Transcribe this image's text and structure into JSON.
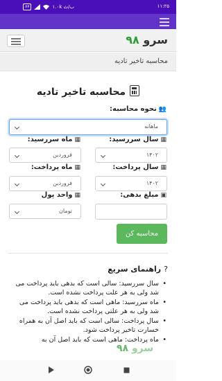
{
  "status_bar": {
    "time": "۱۱:۲۵",
    "network": "۱.۰k ب/ث",
    "battery": "۸۷",
    "wifi_icon": "wifi-icon",
    "signal_icon": "signal-icon"
  },
  "site": {
    "brand_text": "سرو",
    "brand_number": "۹۸",
    "menu_icon": "hamburger-icon"
  },
  "breadcrumb": {
    "current": "محاسبه تاخیر تادیه"
  },
  "page": {
    "title": "محاسبه تاخیر تادیه",
    "title_icon": "calculator-icon"
  },
  "form": {
    "method_label": "نحوه محاسبه:",
    "method_value": "ماهانه",
    "due_year_label": "سال سررسید:",
    "due_year_value": "۱۴۰۲",
    "due_month_label": "ماه سررسید:",
    "due_month_value": "فروردین",
    "pay_year_label": "سال پرداخت:",
    "pay_year_value": "۱۴۰۲",
    "pay_month_label": "ماه پرداخت:",
    "pay_month_value": "فروردین",
    "debt_label": "مبلغ بدهی:",
    "currency_label": "واحد پول",
    "currency_value": "تومان",
    "submit_label": "محاسبه کن"
  },
  "guide": {
    "title": "راهنمای سریع",
    "items": [
      "سال سررسید: سالی است که بدهی باید پرداخت می شد ولی به هر علت پرداخت نشده است.",
      "ماه سررسید: ماهی است که بدهی باید پرداخت می شد ولی به هر علتی پرداخت نشده است.",
      "سال پرداخت: سالی است که باید اصل آن به همراه خسارت تاخیر پرداخت شود.",
      "ماه پرداخت: ماهی است که باید اصل آن به"
    ]
  },
  "watermark": {
    "text": "سرو",
    "number": "۹۸"
  },
  "colors": {
    "status_bar": "#4a0fb8",
    "top_strip": "#6233c9",
    "brand_number": "#2f9e3a",
    "submit_button": "#5cb85c"
  }
}
